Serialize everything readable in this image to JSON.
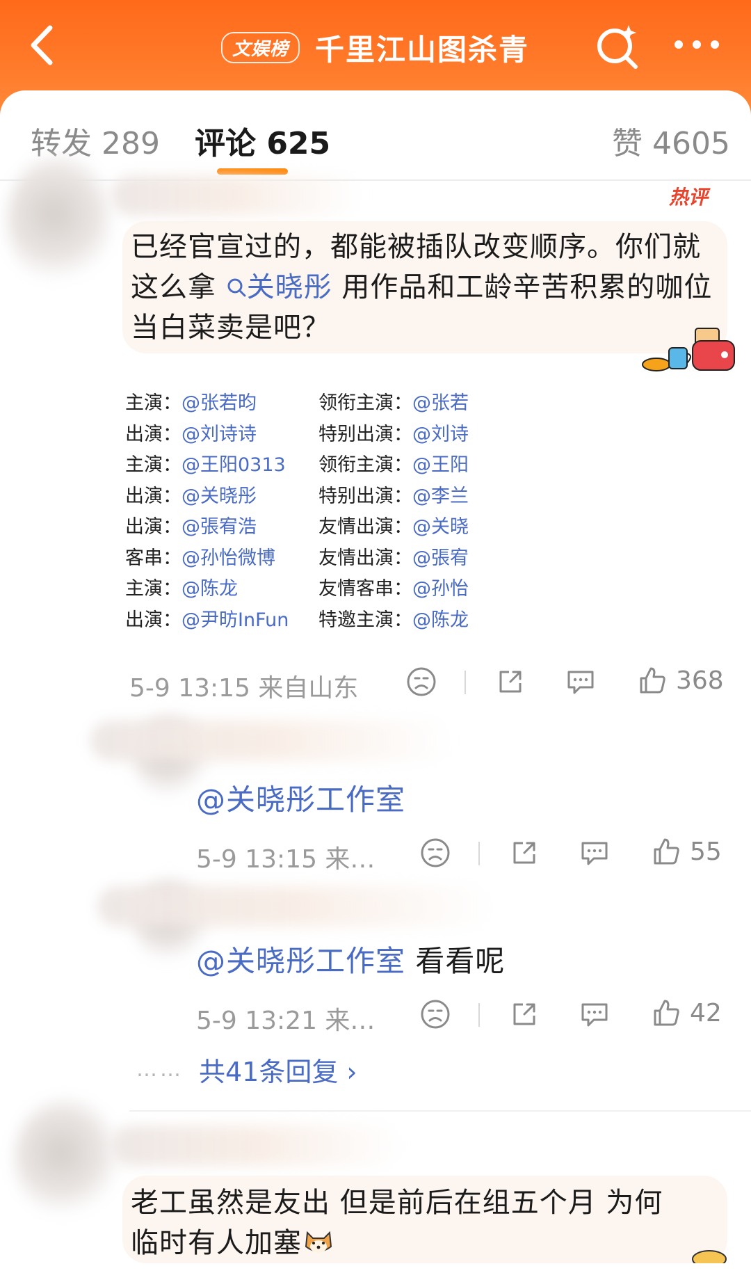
{
  "header": {
    "badge": "文娱榜",
    "title": "千里江山图杀青",
    "icons": [
      "back-icon",
      "search-sparkle-icon",
      "more-dots-icon"
    ],
    "brand_color": "#ff7a24"
  },
  "tabs": [
    {
      "label": "转发 289"
    },
    {
      "label": "评论 625"
    },
    {
      "label": "赞 4605"
    }
  ],
  "comment1": {
    "hot_tag": "热评",
    "text_a": "已经官宣过的，都能被插队改变顺序。你们就这么拿",
    "mention": "关晓彤",
    "text_b": " 用作品和工龄辛苦积累的咖位当白菜卖是吧？",
    "cast_list": {
      "left": [
        {
          "role": "主演：",
          "name": "@张若昀"
        },
        {
          "role": "出演：",
          "name": "@刘诗诗"
        },
        {
          "role": "主演：",
          "name": "@王阳0313"
        },
        {
          "role": "出演：",
          "name": "@关晓彤"
        },
        {
          "role": "出演：",
          "name": "@張宥浩"
        },
        {
          "role": "客串：",
          "name": "@孙怡微博"
        },
        {
          "role": "主演：",
          "name": "@陈龙"
        },
        {
          "role": "出演：",
          "name": "@尹昉InFun"
        }
      ],
      "right": [
        {
          "role": "领衔主演：",
          "name": "@张若"
        },
        {
          "role": "特别出演：",
          "name": "@刘诗"
        },
        {
          "role": "领衔主演：",
          "name": "@王阳"
        },
        {
          "role": "特别出演：",
          "name": "@李兰"
        },
        {
          "role": "友情出演：",
          "name": "@关晓"
        },
        {
          "role": "友情出演：",
          "name": "@張宥"
        },
        {
          "role": "友情客串：",
          "name": "@孙怡"
        },
        {
          "role": "特邀主演：",
          "name": "@陈龙"
        }
      ]
    },
    "meta": "5-9 13:15  来自山东",
    "likes": "368"
  },
  "reply1": {
    "mention": "@关晓彤工作室",
    "text": "",
    "meta": "5-9 13:15  来…",
    "likes": "55"
  },
  "reply2": {
    "mention": "@关晓彤工作室",
    "text": " 看看呢",
    "meta": "5-9 13:21  来…",
    "likes": "42"
  },
  "more_replies": {
    "dots": "……",
    "label": "共41条回复 ›"
  },
  "comment2": {
    "text_a": "老工虽然是友出 但是前后在组五个月 为何",
    "text_b": "临时有人加塞"
  }
}
